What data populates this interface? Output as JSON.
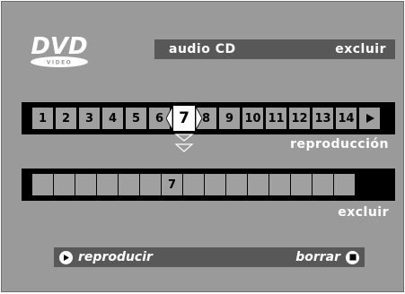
{
  "logo": {
    "icon": "dvd-video-logo-icon",
    "main_text": "DVD",
    "sub_text": "VIDEO"
  },
  "header": {
    "mode": "audio CD",
    "action": "excluir"
  },
  "tracks": {
    "cells": [
      "1",
      "2",
      "3",
      "4",
      "5",
      "6",
      "7",
      "8",
      "9",
      "10",
      "11",
      "12",
      "13",
      "14"
    ],
    "selected": "7",
    "next_icon": "play-arrow-icon"
  },
  "labels": {
    "playback": "reproducción",
    "exclude": "excluir"
  },
  "excluded": {
    "cells": [
      "",
      "",
      "",
      "",
      "",
      "",
      "7",
      "",
      "",
      "",
      "",
      "",
      "",
      "",
      ""
    ]
  },
  "bottom": {
    "play_label": "reproducir",
    "play_icon": "play-circle-icon",
    "delete_label": "borrar",
    "delete_icon": "stop-circle-icon"
  },
  "colors": {
    "background": "#9a9a9a",
    "bar": "#585858",
    "strip": "#000000",
    "cell": "#a0a0a0",
    "text": "#ffffff"
  }
}
